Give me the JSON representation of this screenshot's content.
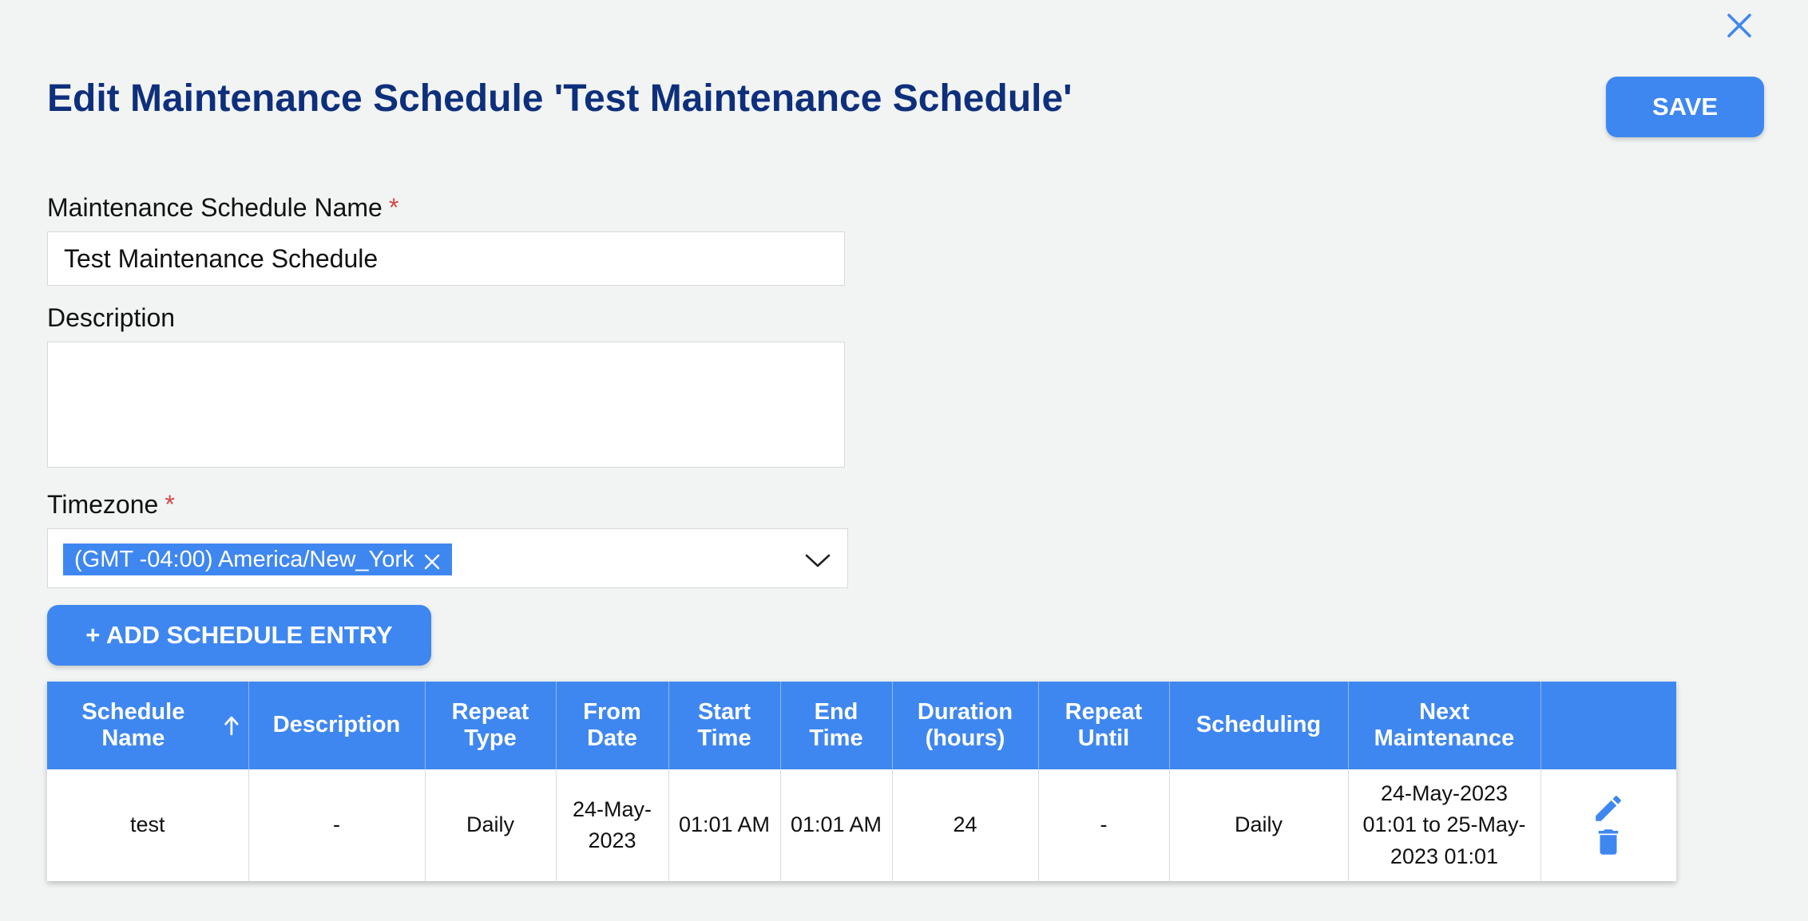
{
  "header": {
    "title": "Edit Maintenance Schedule 'Test Maintenance Schedule'",
    "save_label": "SAVE"
  },
  "form": {
    "name_label": "Maintenance Schedule Name",
    "name_value": "Test Maintenance Schedule",
    "description_label": "Description",
    "description_value": "",
    "timezone_label": "Timezone",
    "timezone_value": "(GMT -04:00) America/New_York",
    "required_marker": "*"
  },
  "add_entry_label": "+ ADD SCHEDULE ENTRY",
  "table": {
    "columns": [
      "Schedule Name",
      "Description",
      "Repeat Type",
      "From Date",
      "Start Time",
      "End Time",
      "Duration (hours)",
      "Repeat Until",
      "Scheduling",
      "Next Maintenance",
      ""
    ],
    "rows": [
      {
        "schedule_name": "test",
        "description": "-",
        "repeat_type": "Daily",
        "from_date": "24-May-2023",
        "start_time": "01:01 AM",
        "end_time": "01:01 AM",
        "duration": "24",
        "repeat_until": "-",
        "scheduling": "Daily",
        "next_maintenance": "24-May-2023 01:01 to 25-May-2023 01:01"
      }
    ]
  },
  "colors": {
    "accent": "#3f87f0",
    "title": "#0e2f7c",
    "required": "#d64545",
    "background": "#f1f4f3"
  },
  "icons": {
    "close": "close-icon",
    "chip_remove": "close-icon",
    "dropdown": "chevron-down-icon",
    "sort": "arrow-up-icon",
    "edit": "pencil-icon",
    "delete": "trash-icon"
  }
}
